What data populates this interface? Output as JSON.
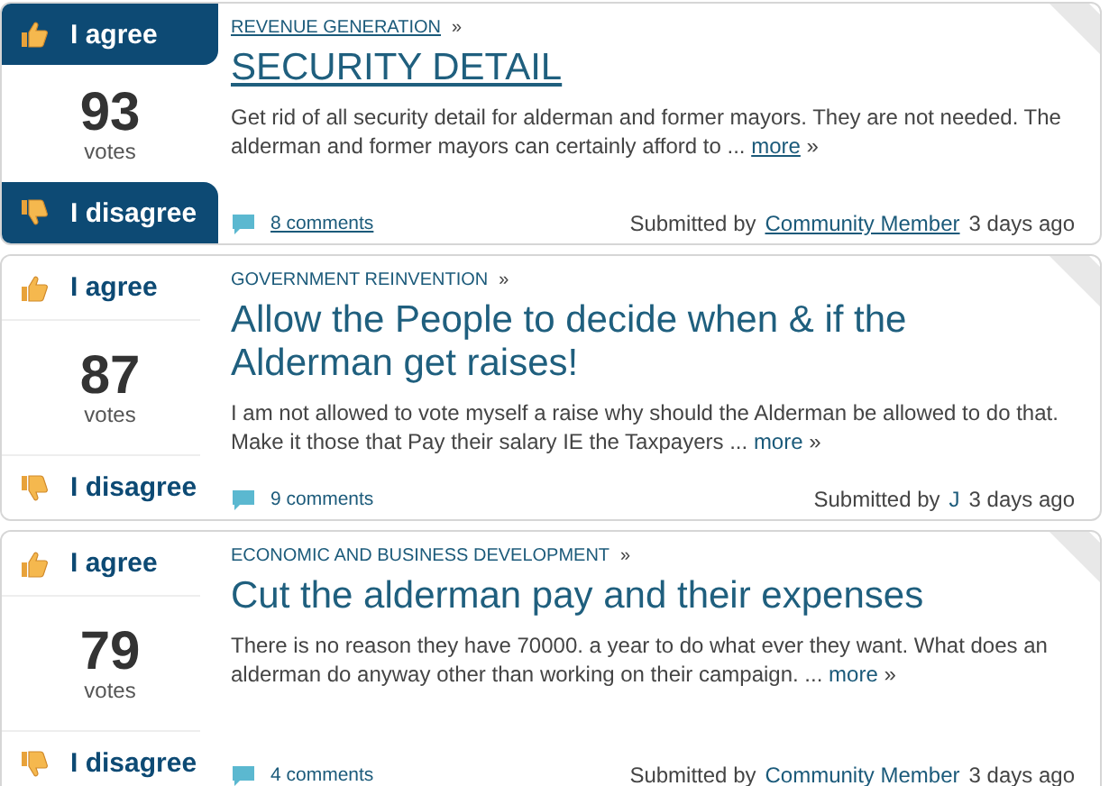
{
  "ideas": [
    {
      "highlighted": true,
      "agree": "I agree",
      "disagree": "I disagree",
      "votes": "93",
      "votes_label": "votes",
      "category": "REVENUE GENERATION",
      "category_sep": "»",
      "title": "SECURITY DETAIL",
      "body": "Get rid of all security detail for alderman and former mayors. They are not needed. The alderman and former mayors can certainly afford to ...",
      "more": "more",
      "more_sep": "»",
      "comments": "8 comments",
      "submitted_label": "Submitted by",
      "author": "Community Member",
      "age": "3 days ago"
    },
    {
      "highlighted": false,
      "agree": "I agree",
      "disagree": "I disagree",
      "votes": "87",
      "votes_label": "votes",
      "category": "GOVERNMENT REINVENTION",
      "category_sep": "»",
      "title": "Allow the People to decide when & if the Alderman get raises!",
      "body": "I am not allowed to vote myself a raise why should the Alderman be allowed to do that. Make it those that Pay their salary IE the Taxpayers ...",
      "more": "more",
      "more_sep": "»",
      "comments": "9 comments",
      "submitted_label": "Submitted by",
      "author": "J",
      "age": "3 days ago"
    },
    {
      "highlighted": false,
      "agree": "I agree",
      "disagree": "I disagree",
      "votes": "79",
      "votes_label": "votes",
      "category": "ECONOMIC AND BUSINESS DEVELOPMENT",
      "category_sep": "»",
      "title": "Cut the alderman pay and their expenses",
      "body": "There is no reason they have 70000. a year to do what ever they want. What does an alderman do anyway other than working on their campaign. ...",
      "more": "more",
      "more_sep": "»",
      "comments": "4 comments",
      "submitted_label": "Submitted by",
      "author": "Community Member",
      "age": "3 days ago"
    }
  ]
}
